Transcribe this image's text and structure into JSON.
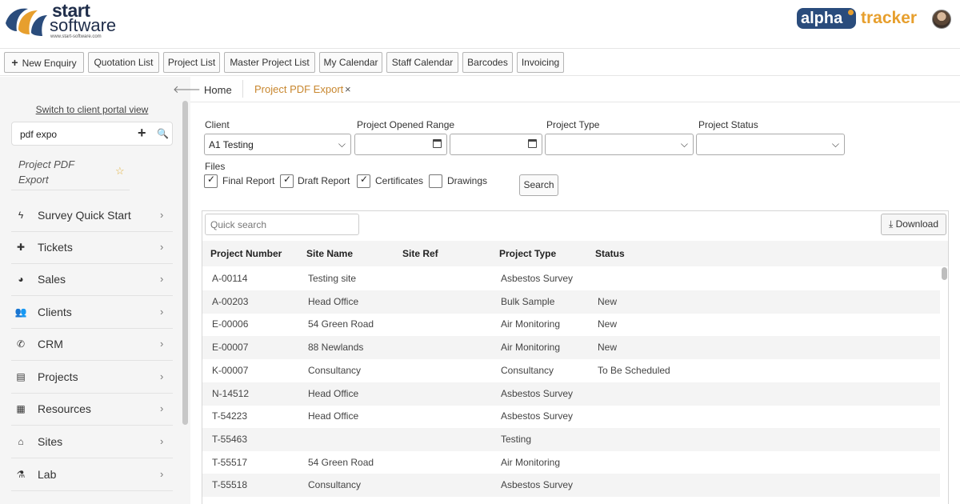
{
  "brand": {
    "start": "start",
    "software": "software",
    "url": "www.start-software.com",
    "alpha": "alpha",
    "tracker": "tracker",
    "colors": {
      "navy": "#2a4c7c",
      "orange": "#e79f2d"
    }
  },
  "toolbar": {
    "new_enquiry": "New Enquiry",
    "quotation_list": "Quotation List",
    "project_list": "Project List",
    "master_project_list": "Master Project List",
    "my_calendar": "My Calendar",
    "staff_calendar": "Staff Calendar",
    "barcodes": "Barcodes",
    "invoicing": "Invoicing"
  },
  "sidebar": {
    "portal_link": "Switch to client portal view",
    "search_value": "pdf expo",
    "result": "Project PDF Export",
    "items": [
      {
        "label": "Survey Quick Start",
        "icon": "bolt-icon",
        "glyph": "ϟ"
      },
      {
        "label": "Tickets",
        "icon": "plus-icon",
        "glyph": "✚"
      },
      {
        "label": "Sales",
        "icon": "pie-chart-icon",
        "glyph": "◕"
      },
      {
        "label": "Clients",
        "icon": "users-icon",
        "glyph": "👥"
      },
      {
        "label": "CRM",
        "icon": "phone-icon",
        "glyph": "✆"
      },
      {
        "label": "Projects",
        "icon": "list-icon",
        "glyph": "▤"
      },
      {
        "label": "Resources",
        "icon": "calendar-icon",
        "glyph": "▦"
      },
      {
        "label": "Sites",
        "icon": "home-icon",
        "glyph": "⌂"
      },
      {
        "label": "Lab",
        "icon": "flask-icon",
        "glyph": "⚗"
      }
    ]
  },
  "tabs": {
    "home": "Home",
    "active": "Project PDF Export",
    "close": "×"
  },
  "filters": {
    "client_label": "Client",
    "client_value": "A1 Testing",
    "opened_range_label": "Project Opened Range",
    "type_label": "Project Type",
    "status_label": "Project Status",
    "files_label": "Files",
    "files": [
      {
        "label": "Final Report",
        "checked": true
      },
      {
        "label": "Draft Report",
        "checked": true
      },
      {
        "label": "Certificates",
        "checked": true
      },
      {
        "label": "Drawings",
        "checked": false
      }
    ],
    "search_button": "Search"
  },
  "results": {
    "quick_search_placeholder": "Quick search",
    "download": "Download",
    "columns": [
      "Project Number",
      "Site Name",
      "Site Ref",
      "Project Type",
      "Status"
    ],
    "rows": [
      [
        "A-00114",
        "Testing site",
        "",
        "Asbestos Survey",
        ""
      ],
      [
        "A-00203",
        "Head Office",
        "",
        "Bulk Sample",
        "New"
      ],
      [
        "E-00006",
        "54 Green Road",
        "",
        "Air Monitoring",
        "New"
      ],
      [
        "E-00007",
        "88 Newlands",
        "",
        "Air Monitoring",
        "New"
      ],
      [
        "K-00007",
        "Consultancy",
        "",
        "Consultancy",
        "To Be Scheduled"
      ],
      [
        "N-14512",
        "Head Office",
        "",
        "Asbestos Survey",
        ""
      ],
      [
        "T-54223",
        "Head Office",
        "",
        "Asbestos Survey",
        ""
      ],
      [
        "T-55463",
        "",
        "",
        "Testing",
        ""
      ],
      [
        "T-55517",
        "54 Green Road",
        "",
        "Air Monitoring",
        ""
      ],
      [
        "T-55518",
        "Consultancy",
        "",
        "Asbestos Survey",
        ""
      ]
    ]
  }
}
